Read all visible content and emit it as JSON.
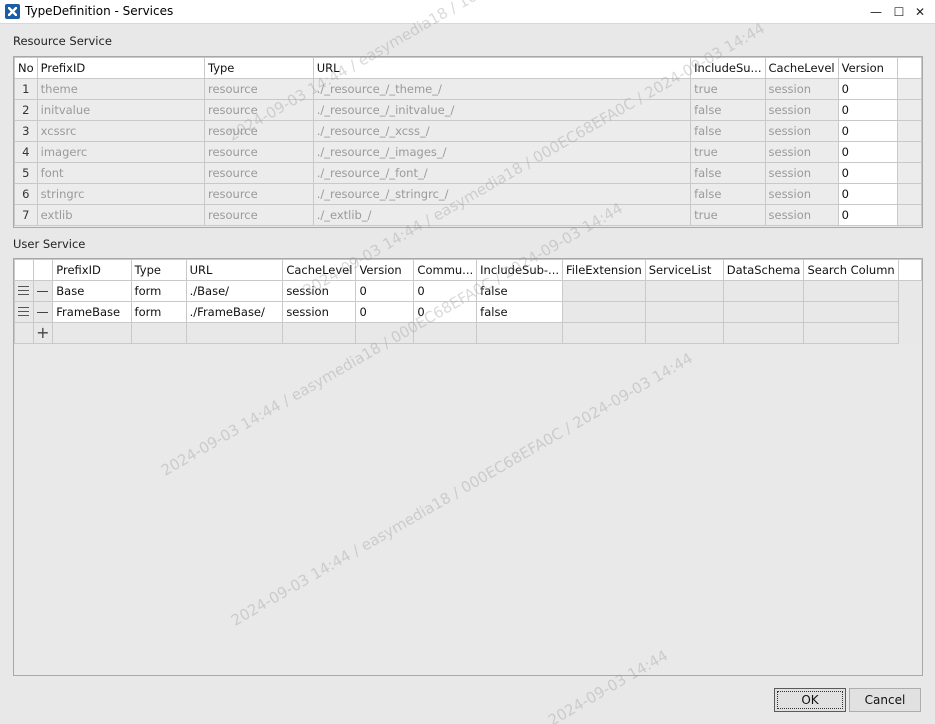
{
  "window": {
    "title": "TypeDefinition - Services"
  },
  "resource": {
    "label": "Resource Service",
    "columns": [
      "No",
      "PrefixID",
      "Type",
      "URL",
      "IncludeSu...",
      "CacheLevel",
      "Version"
    ],
    "rows": [
      [
        "1",
        "theme",
        "resource",
        "./_resource_/_theme_/",
        "true",
        "session",
        "0"
      ],
      [
        "2",
        "initvalue",
        "resource",
        "./_resource_/_initvalue_/",
        "false",
        "session",
        "0"
      ],
      [
        "3",
        "xcssrc",
        "resource",
        "./_resource_/_xcss_/",
        "false",
        "session",
        "0"
      ],
      [
        "4",
        "imagerc",
        "resource",
        "./_resource_/_images_/",
        "true",
        "session",
        "0"
      ],
      [
        "5",
        "font",
        "resource",
        "./_resource_/_font_/",
        "false",
        "session",
        "0"
      ],
      [
        "6",
        "stringrc",
        "resource",
        "./_resource_/_stringrc_/",
        "false",
        "session",
        "0"
      ],
      [
        "7",
        "extlib",
        "resource",
        "./_extlib_/",
        "true",
        "session",
        "0"
      ]
    ]
  },
  "user": {
    "label": "User Service",
    "columns": [
      "PrefixID",
      "Type",
      "URL",
      "CacheLevel",
      "Version",
      "Commu...",
      "IncludeSub-...",
      "FileExtension",
      "ServiceList",
      "DataSchema",
      "Search Column"
    ],
    "rows": [
      [
        "Base",
        "form",
        "./Base/",
        "session",
        "0",
        "0",
        "false",
        "",
        "",
        "",
        ""
      ],
      [
        "FrameBase",
        "form",
        "./FrameBase/",
        "session",
        "0",
        "0",
        "false",
        "",
        "",
        "",
        ""
      ]
    ]
  },
  "watermarks": [
    "2024-09-03 14:44 / easymedia18 / 000EC68EFA0C / 2024-09-03 14:44",
    "2024-09-03 14:44 / easymedia18 / 10.86.162 / 2024-09-03 14:44",
    "2024-09-03 14:44 / easymedia18 / 000EC68EFA0C / 2024-09-03 14:44",
    "2024-09-03 14:44 / easymedia18 / 000EC68EFA0C / 2024-09-03 14:44",
    "2024-09-03 14:44"
  ],
  "buttons": {
    "ok": "OK",
    "cancel": "Cancel"
  },
  "controls": {
    "minimize": "—",
    "maximize": "☐",
    "close": "✕"
  }
}
